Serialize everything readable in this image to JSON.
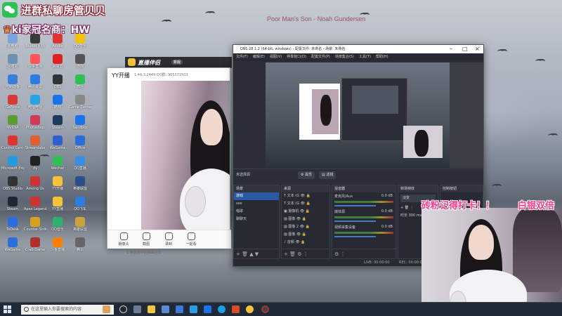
{
  "desktop": {
    "song": "Poor Man's Son - Noah Gundersen",
    "wechat_title": "进群私聊房管贝贝",
    "wechat_sub": "ki家冠名商：HW",
    "icons": [
      {
        "label": "此电脑",
        "color": "#7aa5d8"
      },
      {
        "label": "Studio 图标",
        "color": "#3a3a3a"
      },
      {
        "label": "Adobe",
        "color": "#d33"
      },
      {
        "label": "QQ音乐",
        "color": "#f2c300"
      },
      {
        "label": "回收站",
        "color": "#6d8fb0"
      },
      {
        "label": "快手直播",
        "color": "#f55"
      },
      {
        "label": "网易云",
        "color": "#d22"
      },
      {
        "label": "游戏",
        "color": "#555"
      },
      {
        "label": "控制面板",
        "color": "#3b7dd8"
      },
      {
        "label": "腾讯会议",
        "color": "#2a7de1"
      },
      {
        "label": "OBS",
        "color": "#333"
      },
      {
        "label": "微信",
        "color": "#2fbf54"
      },
      {
        "label": "GeForce",
        "color": "#d83a3a"
      },
      {
        "label": "哔哩哔哩",
        "color": "#2aa4e0"
      },
      {
        "label": "酷狗",
        "color": "#1a73e8"
      },
      {
        "label": "Game Center",
        "color": "#888"
      },
      {
        "label": "NVIDIA",
        "color": "#5b9e2f"
      },
      {
        "label": "Photoshop",
        "color": "#d33a5a"
      },
      {
        "label": "Steam",
        "color": "#1e3a5c"
      },
      {
        "label": "Sandbox",
        "color": "#1a73e8"
      },
      {
        "label": "Control Center",
        "color": "#d33"
      },
      {
        "label": "Streamlabs",
        "color": "#e06030"
      },
      {
        "label": "WeGame",
        "color": "#3060d0"
      },
      {
        "label": "Office",
        "color": "#2b6cd8"
      },
      {
        "label": "Microsoft Edge",
        "color": "#1e9de0"
      },
      {
        "label": "dy",
        "color": "#222"
      },
      {
        "label": "Wechat",
        "color": "#2fbf54"
      },
      {
        "label": "QQ直播",
        "color": "#3a8fe0"
      },
      {
        "label": "OBS Studio",
        "color": "#333"
      },
      {
        "label": "Among Us",
        "color": "#c33"
      },
      {
        "label": "YY开播",
        "color": "#f5c23a"
      },
      {
        "label": "英雄联盟",
        "color": "#2a4f8a"
      },
      {
        "label": "Steam",
        "color": "#1b2838"
      },
      {
        "label": "Apex Legends",
        "color": "#c33"
      },
      {
        "label": "YY直播",
        "color": "#f5c23a"
      },
      {
        "label": "QQ飞车",
        "color": "#2c7fe0"
      },
      {
        "label": "ToDesk",
        "color": "#2a6de0"
      },
      {
        "label": "Counter-Strike",
        "color": "#d8a020"
      },
      {
        "label": "QQ音乐",
        "color": "#30b070"
      },
      {
        "label": "英雄联盟",
        "color": "#c9a43a"
      },
      {
        "label": "WeGame",
        "color": "#2c6fd8"
      },
      {
        "label": "Crab Game",
        "color": "#b03030"
      },
      {
        "label": "斗鱼直播",
        "color": "#ff7f00"
      },
      {
        "label": "腾讯",
        "color": "#666"
      }
    ]
  },
  "yy": {
    "brand": "直播伴侣",
    "brand_tag": "新版",
    "title": "YY开播",
    "version": "1.44.3.2449  QQ群: 905371503",
    "tools": [
      "摄像头",
      "截图",
      "录制",
      "一起看"
    ],
    "notice": "1 条直播中的弹幕信息"
  },
  "obs": {
    "title": "OBS 28.1.2 (64-bit, windows) - 配置文件: 未命名 - 场景: 未命名",
    "menu": [
      "文件(F)",
      "编辑(E)",
      "视图(V)",
      "停靠窗口(D)",
      "配置文件(P)",
      "场景集合(S)",
      "工具(T)",
      "帮助(H)"
    ],
    "no_source": "未选择源",
    "props_btn": "属性",
    "filters_btn": "滤镜",
    "docks": {
      "scenes_title": "场景",
      "scenes": [
        "游戏",
        "see",
        "唱歌",
        "聊聊天"
      ],
      "sources_title": "来源",
      "sources": [
        "文本 (G",
        "文本 (G",
        "摄像机",
        "图像",
        "图像 2",
        "图像",
        "音频"
      ],
      "mixer_title": "混音器",
      "mixer": [
        {
          "name": "麦克风/Aux",
          "db": "0.0 dB"
        },
        {
          "name": "媒体源",
          "db": "0.0 dB"
        },
        {
          "name": "视频采集设备",
          "db": "0.0 dB"
        }
      ],
      "transitions_title": "转场特效",
      "transition": "淡变",
      "duration_label": "时长",
      "duration": "300 ms",
      "controls_title": "控制按钮"
    },
    "status_live": "LIVE: 00:00:00",
    "status_rec": "REC: 00:00:00"
  },
  "overlay": {
    "chat1": "砖粉记得打卡！！",
    "chat2": "白银双倍"
  },
  "taskbar": {
    "search_placeholder": "在这里输入你要搜索的内容"
  }
}
